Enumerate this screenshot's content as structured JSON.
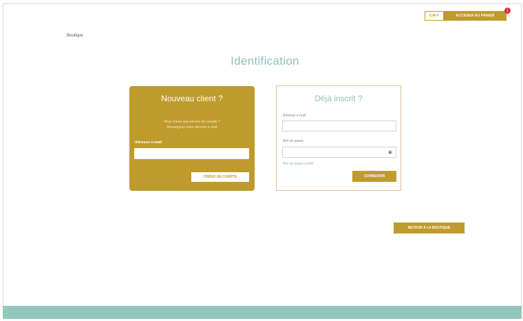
{
  "header": {
    "cart_amount": "0,00 €",
    "cart_button_label": "ACCEDER AU PANIER",
    "cart_count": "1"
  },
  "breadcrumb": "Boutique",
  "page_title": "Identification",
  "new_client": {
    "title": "Nouveau client ?",
    "text_line1": "Vous n'avez pas encore de compte ?",
    "text_line2": "Renseignez votre adresse e-mail",
    "email_label": "Adresse e-mail",
    "email_value": "",
    "create_button": "CRÉER UN COMPTE"
  },
  "existing_client": {
    "title": "Déjà inscrit ?",
    "email_label": "Adresse e-mail",
    "email_value": "",
    "password_label": "Mot de passe",
    "password_value": "",
    "forgot_link": "Mot de passe oublié",
    "connect_button": "CONNEXION"
  },
  "back_button": "RETOUR À LA BOUTIQUE",
  "colors": {
    "gold": "#bf9a2d",
    "teal": "#8ec2b7",
    "footer": "#93c7bd",
    "badge": "#e2263c"
  }
}
